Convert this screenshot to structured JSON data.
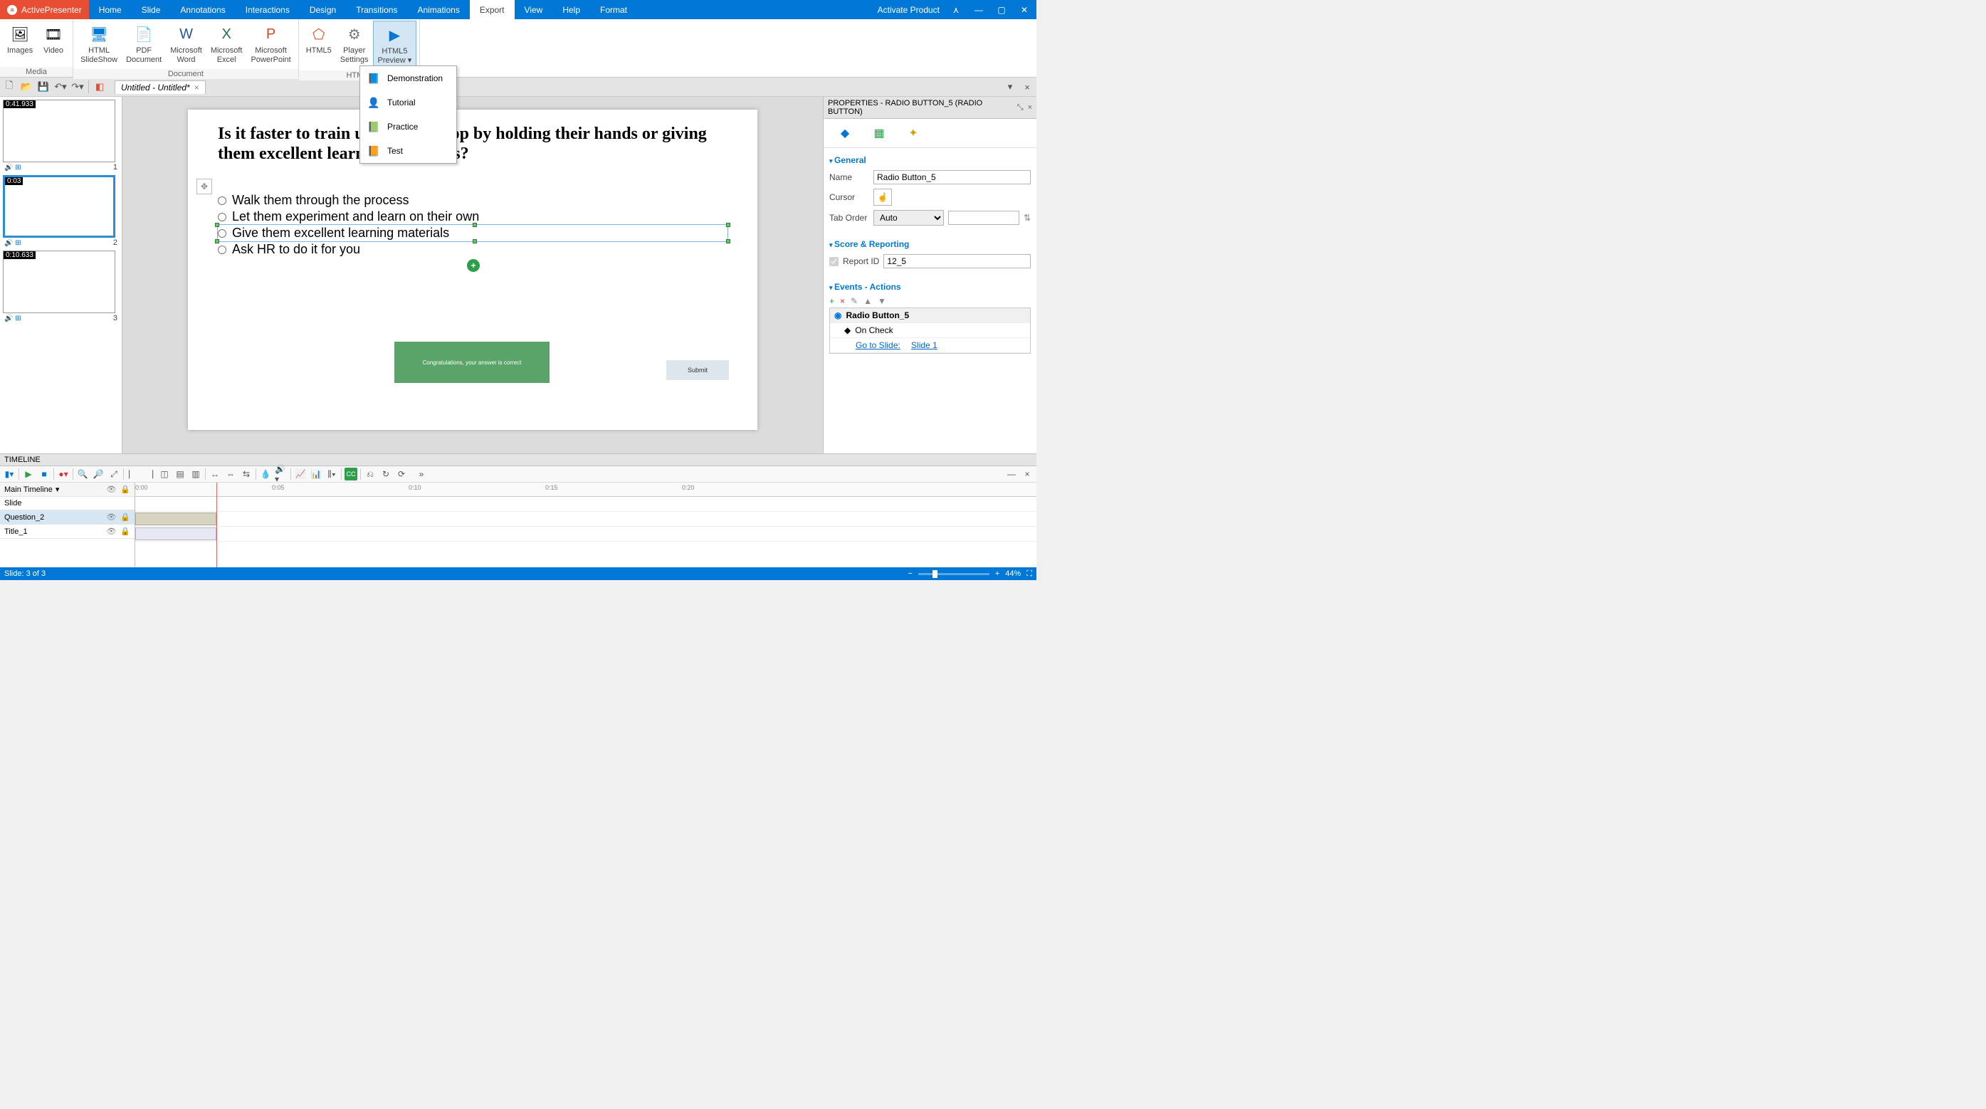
{
  "titlebar": {
    "app_name": "ActivePresenter",
    "tabs": [
      "Home",
      "Slide",
      "Annotations",
      "Interactions",
      "Design",
      "Transitions",
      "Animations",
      "Export",
      "View",
      "Help",
      "Format"
    ],
    "active_tab": "Export",
    "activate": "Activate Product"
  },
  "ribbon": {
    "groups": [
      {
        "label": "Media",
        "buttons": [
          {
            "name": "images-btn",
            "label": "Images"
          },
          {
            "name": "video-btn",
            "label": "Video"
          }
        ]
      },
      {
        "label": "Document",
        "buttons": [
          {
            "name": "html-slideshow-btn",
            "label": "HTML\nSlideShow"
          },
          {
            "name": "pdf-doc-btn",
            "label": "PDF\nDocument"
          },
          {
            "name": "ms-word-btn",
            "label": "Microsoft\nWord"
          },
          {
            "name": "ms-excel-btn",
            "label": "Microsoft\nExcel"
          },
          {
            "name": "ms-ppt-btn",
            "label": "Microsoft\nPowerPoint"
          }
        ]
      },
      {
        "label": "HTML5",
        "buttons": [
          {
            "name": "html5-btn",
            "label": "HTML5"
          },
          {
            "name": "player-settings-btn",
            "label": "Player\nSettings"
          },
          {
            "name": "html5-preview-btn",
            "label": "HTML5\nPreview ▾",
            "pressed": true
          }
        ]
      }
    ]
  },
  "dropdown": {
    "items": [
      {
        "name": "preview-demonstration",
        "label": "Demonstration"
      },
      {
        "name": "preview-tutorial",
        "label": "Tutorial"
      },
      {
        "name": "preview-practice",
        "label": "Practice"
      },
      {
        "name": "preview-test",
        "label": "Test"
      }
    ]
  },
  "doctab": {
    "title": "Untitled - Untitled*"
  },
  "slides": [
    {
      "ts": "0:41.933",
      "num": "1"
    },
    {
      "ts": "0:03",
      "num": "2",
      "selected": true
    },
    {
      "ts": "0:10.633",
      "num": "3"
    }
  ],
  "canvas": {
    "question": "Is it faster to train users on an app by holding their hands or giving them excellent learning materials?",
    "answers": [
      "Walk them through the process",
      "Let them experiment and learn on their own",
      "Give them excellent learning materials",
      "Ask HR to do it for you"
    ],
    "selected_answer_index": 2,
    "congrats": "Congratulations, your answer is correct",
    "submit": "Submit"
  },
  "properties": {
    "header": "PROPERTIES - RADIO BUTTON_5 (RADIO BUTTON)",
    "sections": {
      "general": {
        "title": "General",
        "name_label": "Name",
        "name_value": "Radio Button_5",
        "cursor_label": "Cursor",
        "taborder_label": "Tab Order",
        "taborder_value": "Auto"
      },
      "score": {
        "title": "Score & Reporting",
        "reportid_label": "Report ID",
        "reportid_value": "12_5"
      },
      "events": {
        "title": "Events - Actions",
        "object": "Radio Button_5",
        "event": "On Check",
        "action_label": "Go to Slide:",
        "action_target": "Slide 1"
      }
    }
  },
  "timeline": {
    "title": "TIMELINE",
    "main": "Main Timeline",
    "tracks": [
      "Slide",
      "Question_2",
      "Title_1"
    ],
    "marks": [
      "0:00",
      "0:05",
      "0:10",
      "0:15",
      "0:20"
    ]
  },
  "status": {
    "left": "Slide: 3 of 3",
    "zoom": "44%"
  }
}
